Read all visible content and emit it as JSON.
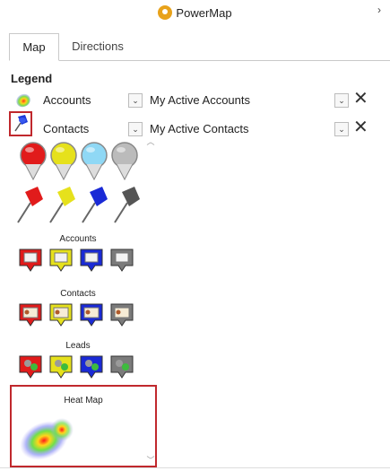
{
  "header": {
    "title": "PowerMap",
    "collapse_glyph": "›"
  },
  "tabs": [
    {
      "label": "Map",
      "active": true
    },
    {
      "label": "Directions",
      "active": false
    }
  ],
  "legend": {
    "title": "Legend",
    "rows": [
      {
        "layer": "Accounts",
        "view": "My Active Accounts"
      },
      {
        "layer": "Contacts",
        "view": "My Active Contacts"
      }
    ]
  },
  "icon_picker": {
    "sections": [
      "Accounts",
      "Contacts",
      "Leads",
      "Heat Map"
    ],
    "colors": [
      "#e11b1b",
      "#e6e11c",
      "#1a2ad6",
      "#7b7b7b"
    ]
  },
  "icons": {
    "logo": "powermap-logo-icon",
    "close": "close-icon",
    "dropdown": "chevron-down-icon"
  }
}
